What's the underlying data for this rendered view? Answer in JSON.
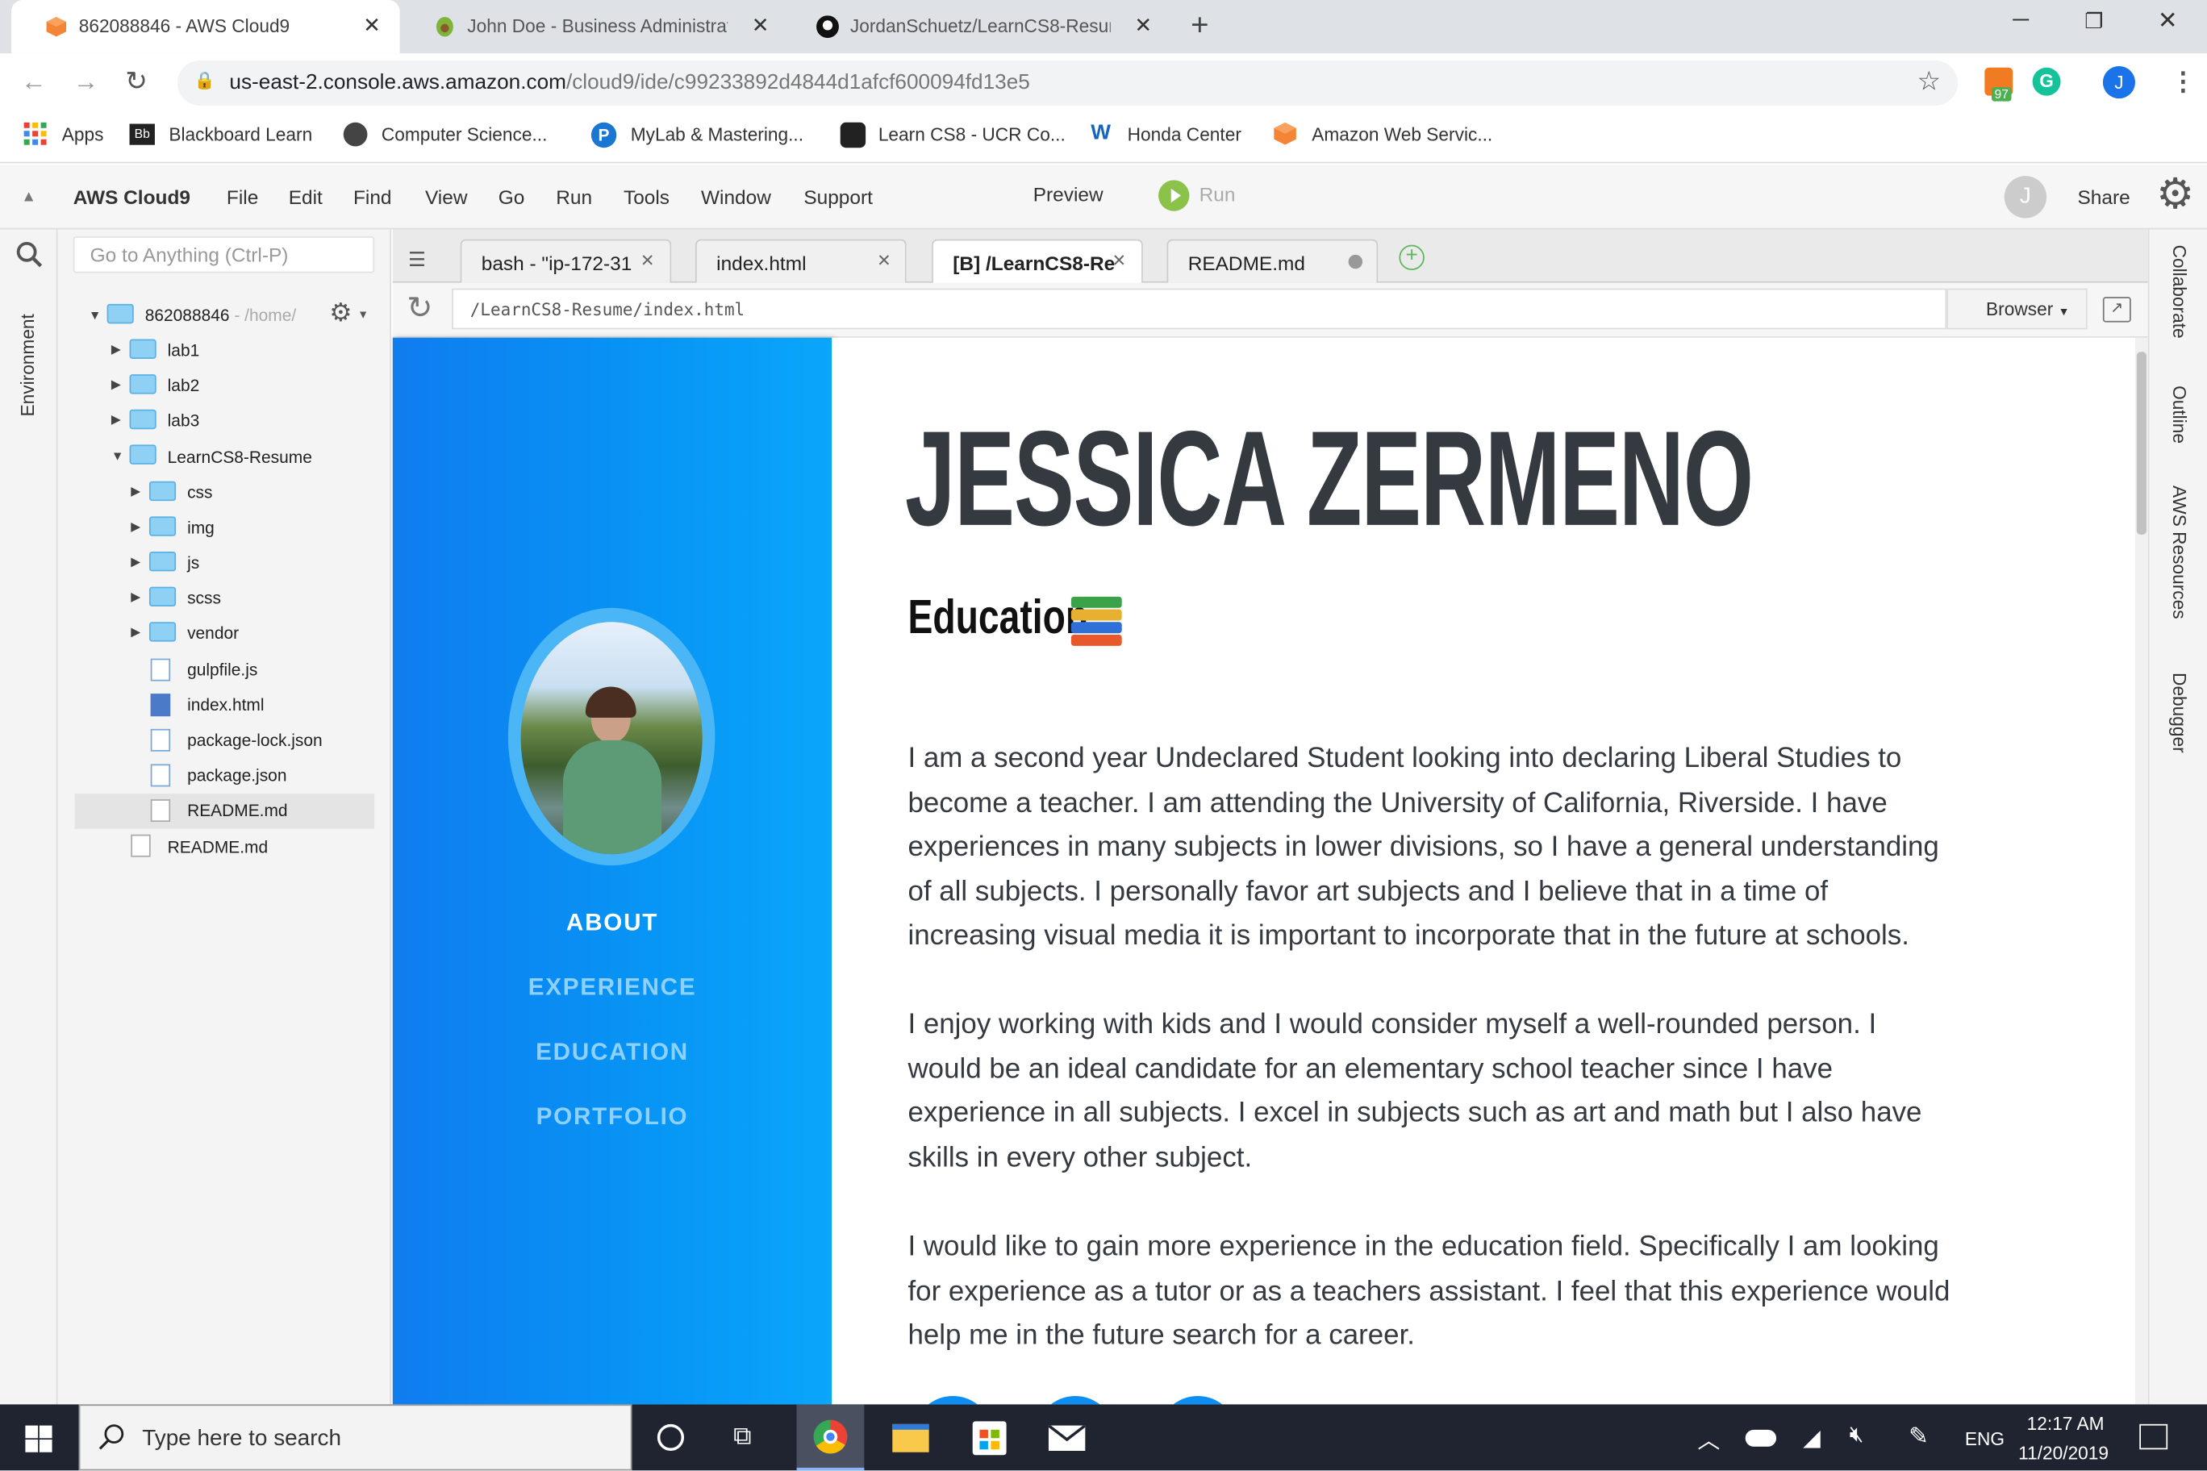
{
  "browser": {
    "tabs": [
      {
        "title": "862088846 - AWS Cloud9",
        "active": true
      },
      {
        "title": "John Doe - Business Administrati",
        "active": false
      },
      {
        "title": "JordanSchuetz/LearnCS8-Resume",
        "active": false
      }
    ],
    "url_host": "us-east-2.console.aws.amazon.com",
    "url_path": "/cloud9/ide/c99233892d4844d1afcf600094fd13e5",
    "extension_badge": "97",
    "profile_initial": "J",
    "bookmarks": [
      "Apps",
      "Blackboard Learn",
      "Computer Science...",
      "MyLab & Mastering...",
      "Learn CS8 - UCR Co...",
      "Honda Center",
      "Amazon Web Servic..."
    ]
  },
  "cloud9": {
    "brand": "AWS Cloud9",
    "menu": [
      "File",
      "Edit",
      "Find",
      "View",
      "Go",
      "Run",
      "Tools",
      "Window",
      "Support"
    ],
    "preview_label": "Preview",
    "run_label": "Run",
    "avatar_initial": "J",
    "share_label": "Share",
    "left_panel_label": "Environment",
    "right_panel_labels": [
      "Collaborate",
      "Outline",
      "AWS Resources",
      "Debugger"
    ],
    "search_placeholder": "Go to Anything (Ctrl-P)",
    "tree": {
      "root": "862088846",
      "root_path": "- /home/",
      "items": [
        "lab1",
        "lab2",
        "lab3",
        "LearnCS8-Resume",
        "css",
        "img",
        "js",
        "scss",
        "vendor",
        "gulpfile.js",
        "index.html",
        "package-lock.json",
        "package.json",
        "README.md",
        "README.md"
      ]
    },
    "editor_tabs": [
      "bash - \"ip-172-31",
      "index.html",
      "[B] /LearnCS8-Re",
      "README.md"
    ],
    "preview_path": "/LearnCS8-Resume/index.html",
    "browser_dropdown": "Browser"
  },
  "resume": {
    "name": "JESSICA ZERMENO",
    "section": "Education",
    "nav": [
      "ABOUT",
      "EXPERIENCE",
      "EDUCATION",
      "PORTFOLIO"
    ],
    "paragraphs": [
      [
        "I am a second year Undeclared Student looking into declaring Liberal Studies to",
        "become a teacher. I am attending the University of California, Riverside. I have",
        "experiences in many subjects in lower divisions, so I have a general understanding",
        "of all subjects. I personally favor art subjects and I believe that in a time of",
        "increasing visual media it is important to incorporate that in the future at schools."
      ],
      [
        "I enjoy working with kids and I would consider myself a well-rounded person. I",
        "would be an ideal candidate for an elementary school teacher since I have",
        "experience in all subjects. I excel in subjects such as art and math but I also have",
        "skills in every other subject."
      ],
      [
        "I would like to gain more experience in the education field. Specifically I am looking",
        "for experience as a tutor or as a teachers assistant. I feel that this experience would",
        "help me in the future search for a career."
      ]
    ]
  },
  "taskbar": {
    "search_placeholder": "Type here to search",
    "language": "ENG",
    "time": "12:17 AM",
    "date": "11/20/2019"
  }
}
